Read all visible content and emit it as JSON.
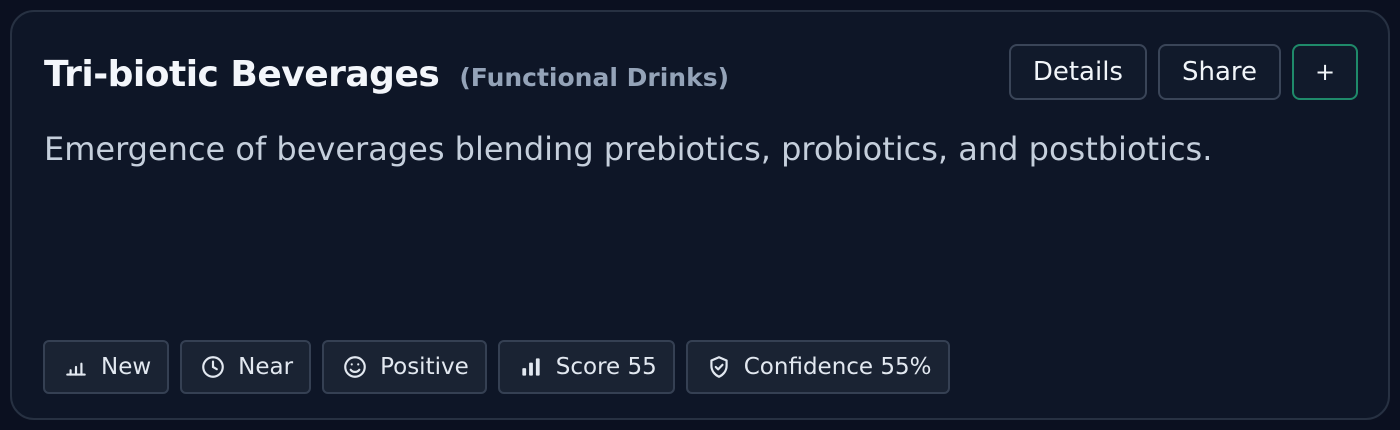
{
  "card": {
    "title": "Tri-biotic Beverages",
    "category": "(Functional Drinks)",
    "description": "Emergence of beverages blending prebiotics, probiotics, and postbiotics."
  },
  "actions": {
    "details_label": "Details",
    "share_label": "Share",
    "add_label": "+"
  },
  "tags": {
    "status": {
      "icon": "bar-chart-small-icon",
      "label": "New"
    },
    "horizon": {
      "icon": "clock-icon",
      "label": "Near"
    },
    "sentiment": {
      "icon": "smiley-icon",
      "label": "Positive"
    },
    "score": {
      "icon": "bar-chart-icon",
      "label": "Score 55"
    },
    "confidence": {
      "icon": "shield-check-icon",
      "label": "Confidence 55%"
    }
  },
  "colors": {
    "page_background": "#0b1020",
    "card_background": "#0e1627",
    "card_border": "#273142",
    "accent_border": "#1f8a6a",
    "title_text": "#f3f6fb",
    "muted_text": "#94a3b8"
  }
}
